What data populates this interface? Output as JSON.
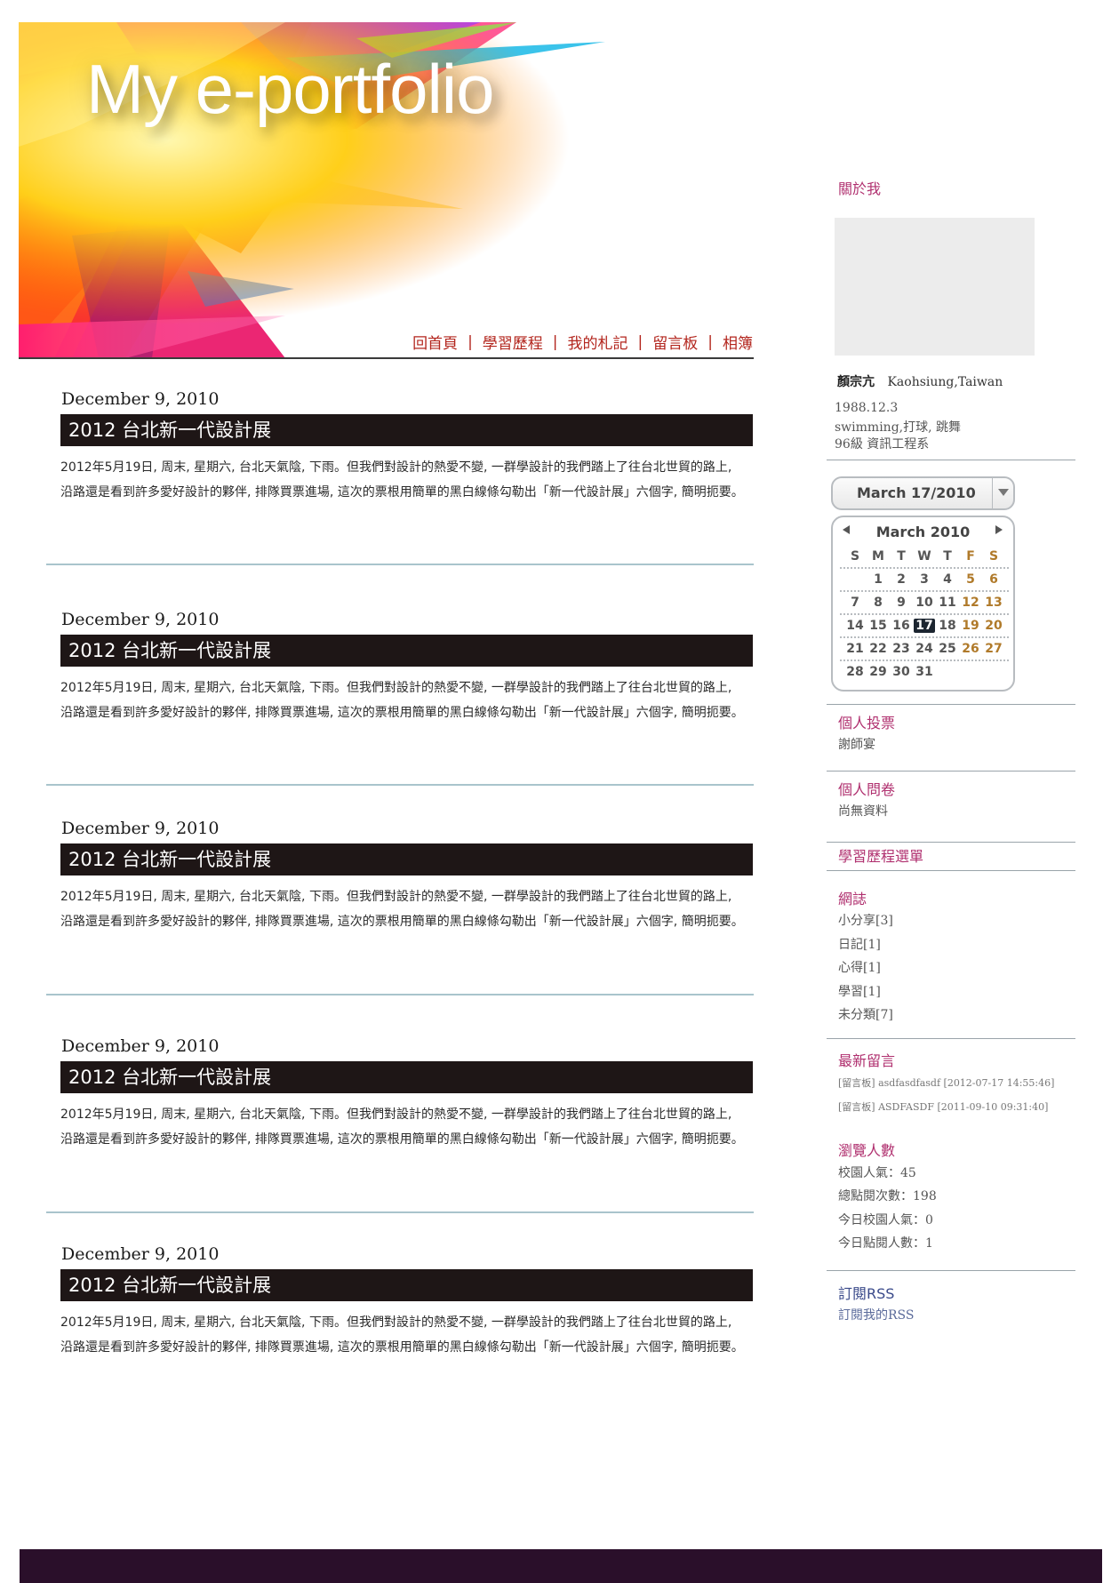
{
  "site": {
    "title": "My e-portfolio",
    "nav": [
      "回首頁",
      "學習歷程",
      "我的札記",
      "留言板",
      "相簿"
    ],
    "nav_separator": "|"
  },
  "posts": [
    {
      "date": "December 9, 2010",
      "title": "2012 台北新一代設計展",
      "body": "2012年5月19日, 周末, 星期六, 台北天氣陰, 下雨。但我們對設計的熱愛不變, 一群學設計的我們踏上了往台北世貿的路上, 沿路還是看到許多愛好設計的夥伴, 排隊買票進場, 這次的票根用簡單的黑白線條勾勒出「新一代設計展」六個字, 簡明扼要。"
    },
    {
      "date": "December 9, 2010",
      "title": "2012 台北新一代設計展",
      "body": "2012年5月19日, 周末, 星期六, 台北天氣陰, 下雨。但我們對設計的熱愛不變, 一群學設計的我們踏上了往台北世貿的路上, 沿路還是看到許多愛好設計的夥伴, 排隊買票進場, 這次的票根用簡單的黑白線條勾勒出「新一代設計展」六個字, 簡明扼要。"
    },
    {
      "date": "December 9, 2010",
      "title": "2012 台北新一代設計展",
      "body": "2012年5月19日, 周末, 星期六, 台北天氣陰, 下雨。但我們對設計的熱愛不變, 一群學設計的我們踏上了往台北世貿的路上, 沿路還是看到許多愛好設計的夥伴, 排隊買票進場, 這次的票根用簡單的黑白線條勾勒出「新一代設計展」六個字, 簡明扼要。"
    },
    {
      "date": "December 9, 2010",
      "title": "2012 台北新一代設計展",
      "body": "2012年5月19日, 周末, 星期六, 台北天氣陰, 下雨。但我們對設計的熱愛不變, 一群學設計的我們踏上了往台北世貿的路上, 沿路還是看到許多愛好設計的夥伴, 排隊買票進場, 這次的票根用簡單的黑白線條勾勒出「新一代設計展」六個字, 簡明扼要。"
    },
    {
      "date": "December 9, 2010",
      "title": "2012 台北新一代設計展",
      "body": "2012年5月19日, 周末, 星期六, 台北天氣陰, 下雨。但我們對設計的熱愛不變, 一群學設計的我們踏上了往台北世貿的路上, 沿路還是看到許多愛好設計的夥伴, 排隊買票進場, 這次的票根用簡單的黑白線條勾勒出「新一代設計展」六個字, 簡明扼要。"
    }
  ],
  "sidebar": {
    "about": {
      "heading": "關於我",
      "name": "顏宗亢",
      "location": "Kaohsiung,Taiwan",
      "birthday": "1988.12.3",
      "hobbies": "swimming,打球, 跳舞",
      "class": "96級 資訊工程系"
    },
    "calendar": {
      "picker_value": "March 17/2010",
      "month_label": "March 2010",
      "weekday_headers": [
        "S",
        "M",
        "T",
        "W",
        "T",
        "F",
        "S"
      ],
      "weeks": [
        [
          "",
          "1",
          "2",
          "3",
          "4",
          "5",
          "6"
        ],
        [
          "7",
          "8",
          "9",
          "10",
          "11",
          "12",
          "13"
        ],
        [
          "14",
          "15",
          "16",
          "17",
          "18",
          "19",
          "20"
        ],
        [
          "21",
          "22",
          "23",
          "24",
          "25",
          "26",
          "27"
        ],
        [
          "28",
          "29",
          "30",
          "31",
          "",
          "",
          ""
        ]
      ],
      "selected_day": "17"
    },
    "vote": {
      "heading": "個人投票",
      "item": "謝師宴"
    },
    "survey": {
      "heading": "個人問卷",
      "item": "尚無資料"
    },
    "learning_menu": {
      "heading": "學習歷程選單"
    },
    "blog": {
      "heading": "網誌",
      "categories": [
        "小分享[3]",
        "日記[1]",
        "心得[1]",
        "學習[1]",
        "未分類[7]"
      ]
    },
    "latest_messages": {
      "heading": "最新留言",
      "items": [
        "[留言板] asdfasdfasdf [2012-07-17 14:55:46]",
        "[留言板] ASDFASDF [2011-09-10 09:31:40]"
      ]
    },
    "visitors": {
      "heading": "瀏覽人數",
      "items": [
        "校園人氣：45",
        "總點閱次數：198",
        "今日校園人氣：0",
        "今日點閱人數：1"
      ]
    },
    "rss": {
      "heading": "訂閱RSS",
      "link": "訂閱我的RSS"
    }
  },
  "colors": {
    "accent_heading": "#b0306f",
    "nav_red": "#b3261e",
    "title_bar": "#1e1616",
    "divider": "#a9c4cc",
    "footer": "#2a0f2a"
  },
  "icons": [
    "left-triangle-icon",
    "right-triangle-icon",
    "dropdown-arrow-icon"
  ]
}
